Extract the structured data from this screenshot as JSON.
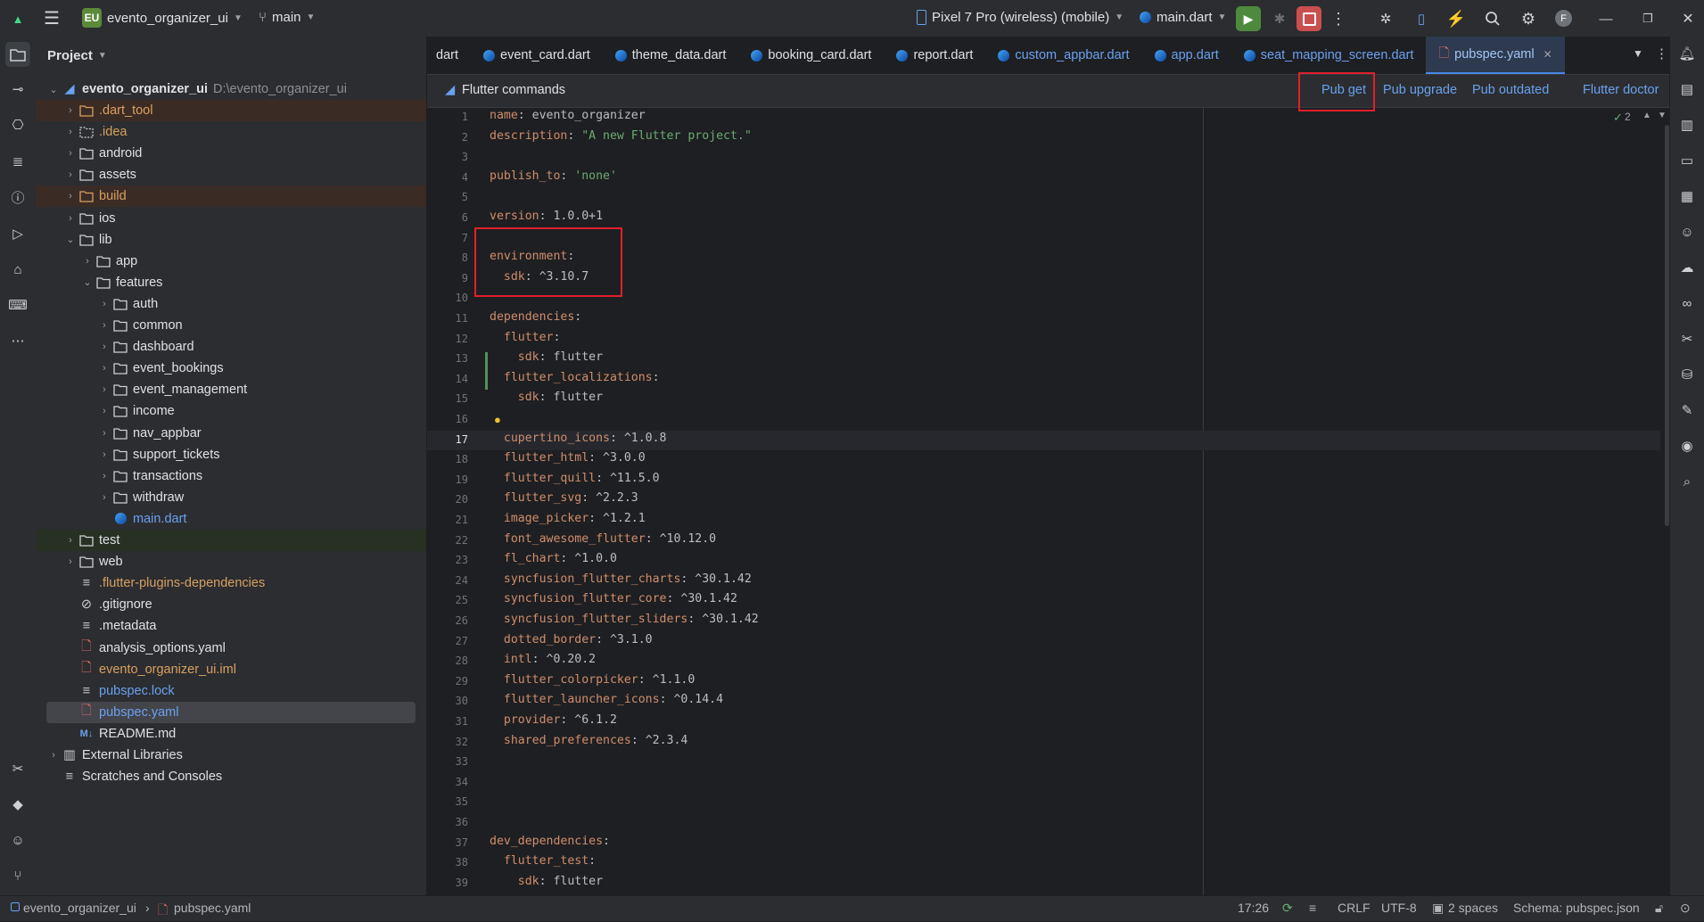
{
  "titlebar": {
    "project_badge": "EU",
    "project_name": "evento_organizer_ui",
    "branch": "main",
    "device": "Pixel 7 Pro (wireless) (mobile)",
    "run_config": "main.dart",
    "avatar_letter": "F"
  },
  "project_panel": {
    "title": "Project",
    "root_name": "evento_organizer_ui",
    "root_path": "D:\\evento_organizer_ui",
    "items": [
      {
        "label": ".dart_tool"
      },
      {
        "label": ".idea"
      },
      {
        "label": "android"
      },
      {
        "label": "assets"
      },
      {
        "label": "build"
      },
      {
        "label": "ios"
      },
      {
        "label": "lib"
      },
      {
        "label": "app"
      },
      {
        "label": "features"
      },
      {
        "label": "auth"
      },
      {
        "label": "common"
      },
      {
        "label": "dashboard"
      },
      {
        "label": "event_bookings"
      },
      {
        "label": "event_management"
      },
      {
        "label": "income"
      },
      {
        "label": "nav_appbar"
      },
      {
        "label": "support_tickets"
      },
      {
        "label": "transactions"
      },
      {
        "label": "withdraw"
      },
      {
        "label": "main.dart"
      },
      {
        "label": "test"
      },
      {
        "label": "web"
      },
      {
        "label": ".flutter-plugins-dependencies"
      },
      {
        "label": ".gitignore"
      },
      {
        "label": ".metadata"
      },
      {
        "label": "analysis_options.yaml"
      },
      {
        "label": "evento_organizer_ui.iml"
      },
      {
        "label": "pubspec.lock"
      },
      {
        "label": "pubspec.yaml"
      },
      {
        "label": "README.md"
      },
      {
        "label": "External Libraries"
      },
      {
        "label": "Scratches and Consoles"
      }
    ]
  },
  "tabs": [
    {
      "label": "dart"
    },
    {
      "label": "event_card.dart"
    },
    {
      "label": "theme_data.dart"
    },
    {
      "label": "booking_card.dart"
    },
    {
      "label": "report.dart"
    },
    {
      "label": "custom_appbar.dart"
    },
    {
      "label": "app.dart"
    },
    {
      "label": "seat_mapping_screen.dart"
    },
    {
      "label": "pubspec.yaml"
    }
  ],
  "command_bar": {
    "title": "Flutter commands",
    "pub_get": "Pub get",
    "pub_upgrade": "Pub upgrade",
    "pub_outdated": "Pub outdated",
    "flutter_doctor": "Flutter doctor",
    "inspection_count": "2"
  },
  "code": {
    "current_line": 17,
    "lines": [
      "name: evento_organizer",
      "description: \"A new Flutter project.\"",
      "",
      "publish_to: 'none'",
      "",
      "version: 1.0.0+1",
      "",
      "environment:",
      "  sdk: ^3.10.7",
      "",
      "dependencies:",
      "  flutter:",
      "    sdk: flutter",
      "  flutter_localizations:",
      "    sdk: flutter",
      "",
      "  cupertino_icons: ^1.0.8",
      "  flutter_html: ^3.0.0",
      "  flutter_quill: ^11.5.0",
      "  flutter_svg: ^2.2.3",
      "  image_picker: ^1.2.1",
      "  font_awesome_flutter: ^10.12.0",
      "  fl_chart: ^1.0.0",
      "  syncfusion_flutter_charts: ^30.1.42",
      "  syncfusion_flutter_core: ^30.1.42",
      "  syncfusion_flutter_sliders: ^30.1.42",
      "  dotted_border: ^3.1.0",
      "  intl: ^0.20.2",
      "  flutter_colorpicker: ^1.1.0",
      "  flutter_launcher_icons: ^0.14.4",
      "  provider: ^6.1.2",
      "  shared_preferences: ^2.3.4",
      "",
      "",
      "",
      "",
      "dev_dependencies:",
      "  flutter_test:",
      "    sdk: flutter",
      ""
    ]
  },
  "statusbar": {
    "breadcrumb_project": "evento_organizer_ui",
    "breadcrumb_file": "pubspec.yaml",
    "position": "17:26",
    "line_ending": "CRLF",
    "encoding": "UTF-8",
    "indent": "2 spaces",
    "schema": "Schema: pubspec.json"
  }
}
